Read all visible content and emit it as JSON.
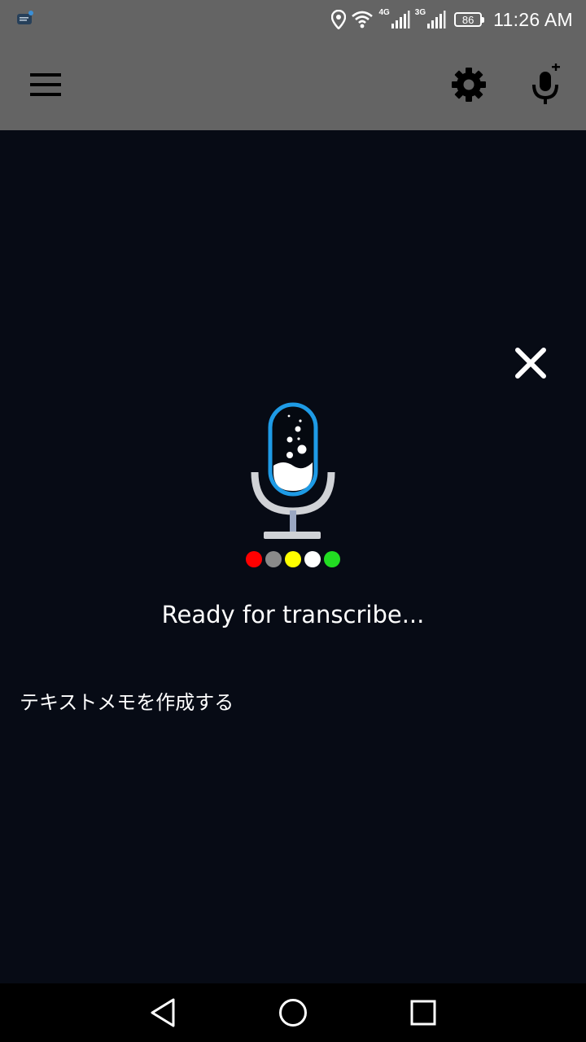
{
  "status_bar": {
    "network_4g": "4G",
    "network_3g": "3G",
    "battery": "86",
    "time": "11:26 AM"
  },
  "app_bar": {
    "menu_icon": "hamburger-menu-icon",
    "settings_icon": "gear-icon",
    "add_mic_icon": "microphone-plus-icon",
    "background": "#646464"
  },
  "main": {
    "close_icon": "close-x-icon",
    "illustration_icon": "microphone-icon",
    "color_dots": [
      {
        "name": "red",
        "color": "#ff0000"
      },
      {
        "name": "gray",
        "color": "#8a8a8a"
      },
      {
        "name": "yellow",
        "color": "#ffff00"
      },
      {
        "name": "white",
        "color": "#ffffff"
      },
      {
        "name": "green",
        "color": "#22dd22"
      }
    ],
    "status_text": "Ready for transcribe...",
    "create_memo_label": "テキストメモを作成する",
    "background": "#070b15",
    "accent": "#1e9be6"
  },
  "nav_bar": {
    "back_icon": "back-triangle-icon",
    "home_icon": "home-circle-icon",
    "recents_icon": "recents-square-icon"
  }
}
